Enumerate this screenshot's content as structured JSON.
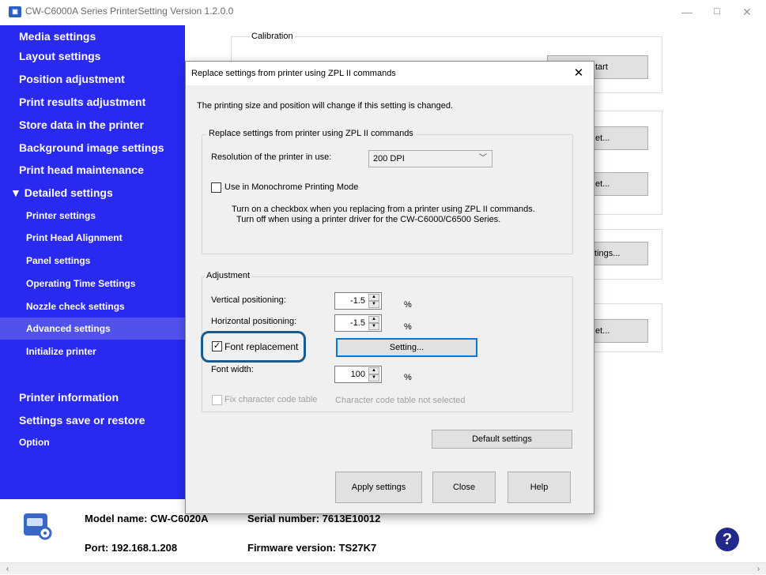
{
  "window": {
    "title": "CW-C6000A Series PrinterSetting Version 1.2.0.0",
    "controls": {
      "minimize": "—",
      "maximize": "☐",
      "close": "✕"
    }
  },
  "sidebar": {
    "items": [
      {
        "label": "Media settings"
      },
      {
        "label": "Layout settings"
      },
      {
        "label": "Position adjustment"
      },
      {
        "label": "Print results adjustment"
      },
      {
        "label": "Store data in the printer"
      },
      {
        "label": "Background image settings"
      },
      {
        "label": "Print head maintenance"
      },
      {
        "label": "▼ Detailed settings"
      },
      {
        "label": "Printer settings"
      },
      {
        "label": "Print Head Alignment"
      },
      {
        "label": "Panel settings"
      },
      {
        "label": "Operating Time Settings"
      },
      {
        "label": "Nozzle check settings"
      },
      {
        "label": "Advanced settings"
      },
      {
        "label": "Initialize printer"
      },
      {
        "label": "Printer information"
      },
      {
        "label": "Settings save or restore"
      },
      {
        "label": "Option"
      }
    ],
    "active_item": "Advanced settings",
    "bg_color": "#2929f0"
  },
  "background": {
    "calibration_label": "Calibration",
    "start_button": "tart",
    "set_button_1": "et...",
    "set_button_2": "et...",
    "settings_button": "ttings...",
    "set_button_3": "et..."
  },
  "info": {
    "model": "Model name: CW-C6020A",
    "port": "Port: 192.168.1.208",
    "serial": "Serial number: 7613E10012",
    "firmware": "Firmware version: TS27K7",
    "help_icon": "?"
  },
  "dialog": {
    "title": "Replace settings from printer using ZPL II commands",
    "close": "✕",
    "note": "The printing size and position will change if this setting is changed.",
    "zpl_group": {
      "legend": "Replace settings from printer using ZPL II commands",
      "resolution_label": "Resolution of the printer in use:",
      "resolution_value": "200 DPI",
      "monochrome_label": "Use in Monochrome Printing Mode",
      "monochrome_checked": false,
      "hint_line1": "Turn on a checkbox when you replacing from a printer using ZPL II commands.",
      "hint_line2": "Turn off when using a printer driver for the CW-C6000/C6500 Series."
    },
    "adjust_group": {
      "legend": "Adjustment",
      "vertical_label": "Vertical positioning:",
      "vertical_value": "-1.5",
      "vertical_unit": "%",
      "horizontal_label": "Horizontal positioning:",
      "horizontal_value": "-1.5",
      "horizontal_unit": "%",
      "font_replacement_label": "Font replacement",
      "font_replacement_checked": true,
      "setting_button": "Setting...",
      "font_width_label": "Font width:",
      "font_width_value": "100",
      "font_width_unit": "%",
      "fix_code_label": "Fix character code table",
      "fix_code_status": "Character code table not selected",
      "default_button": "Default settings"
    },
    "apply_button": "Apply settings",
    "close_button": "Close",
    "help_button": "Help"
  },
  "scrollbar": {
    "left": "‹",
    "right": "›"
  }
}
